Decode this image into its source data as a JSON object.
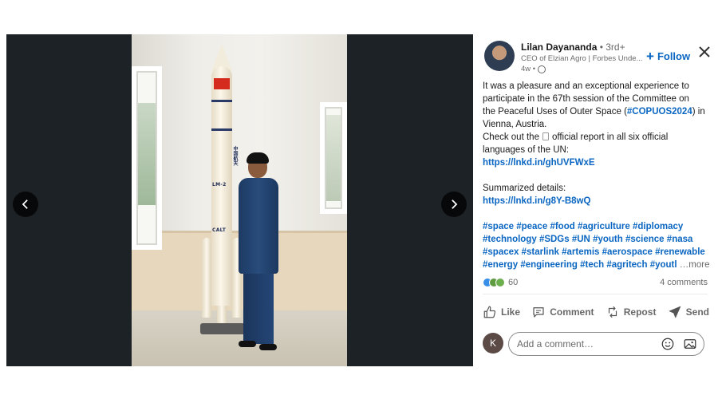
{
  "viewer": {
    "prev_label": "Previous",
    "next_label": "Next",
    "rocket_label_1": "中国航天",
    "rocket_label_2": "LM-2",
    "rocket_label_3": "CALT"
  },
  "author": {
    "name": "Lilan Dayananda",
    "degree": " • 3rd+",
    "headline": "CEO of Elzian Agro | Forbes Unde...",
    "time": "4w •",
    "follow_label": "Follow"
  },
  "post": {
    "line1": "It was a pleasure and an exceptional experience to",
    "line2": "participate in the 67th session of the Committee on",
    "line3a": "the Peaceful Uses of Outer Space (",
    "line3_tag": "#COPUOS2024",
    "line3b": ") in",
    "line4": "Vienna, Austria.",
    "line5a": "Check out the",
    "line5b": "official report in all six official",
    "line6": "languages of the UN:",
    "link1": "https://lnkd.in/ghUVFWxE",
    "summary_label": "Summarized details:",
    "link2": "https://lnkd.in/g8Y-B8wQ",
    "hashtags_line1": [
      "#space",
      "#peace",
      "#food",
      "#agriculture",
      "#diplomacy"
    ],
    "hashtags_line2": [
      "#technology",
      "#SDGs",
      "#UN",
      "#youth",
      "#science",
      "#nasa"
    ],
    "hashtags_line3": [
      "#spacex",
      "#starlink",
      "#artemis",
      "#aerospace",
      "#renewable"
    ],
    "hashtags_line4": [
      "#energy",
      "#engineering",
      "#tech",
      "#agritech",
      "#youtl"
    ],
    "more_label": "…more"
  },
  "social": {
    "reaction_count": "60",
    "comments_count": "4 comments"
  },
  "actions": {
    "like": "Like",
    "comment": "Comment",
    "repost": "Repost",
    "send": "Send"
  },
  "comment": {
    "avatar_initial": "K",
    "placeholder": "Add a comment…"
  },
  "colors": {
    "link": "#0a66c2",
    "viewer_bg": "#1d2226"
  }
}
